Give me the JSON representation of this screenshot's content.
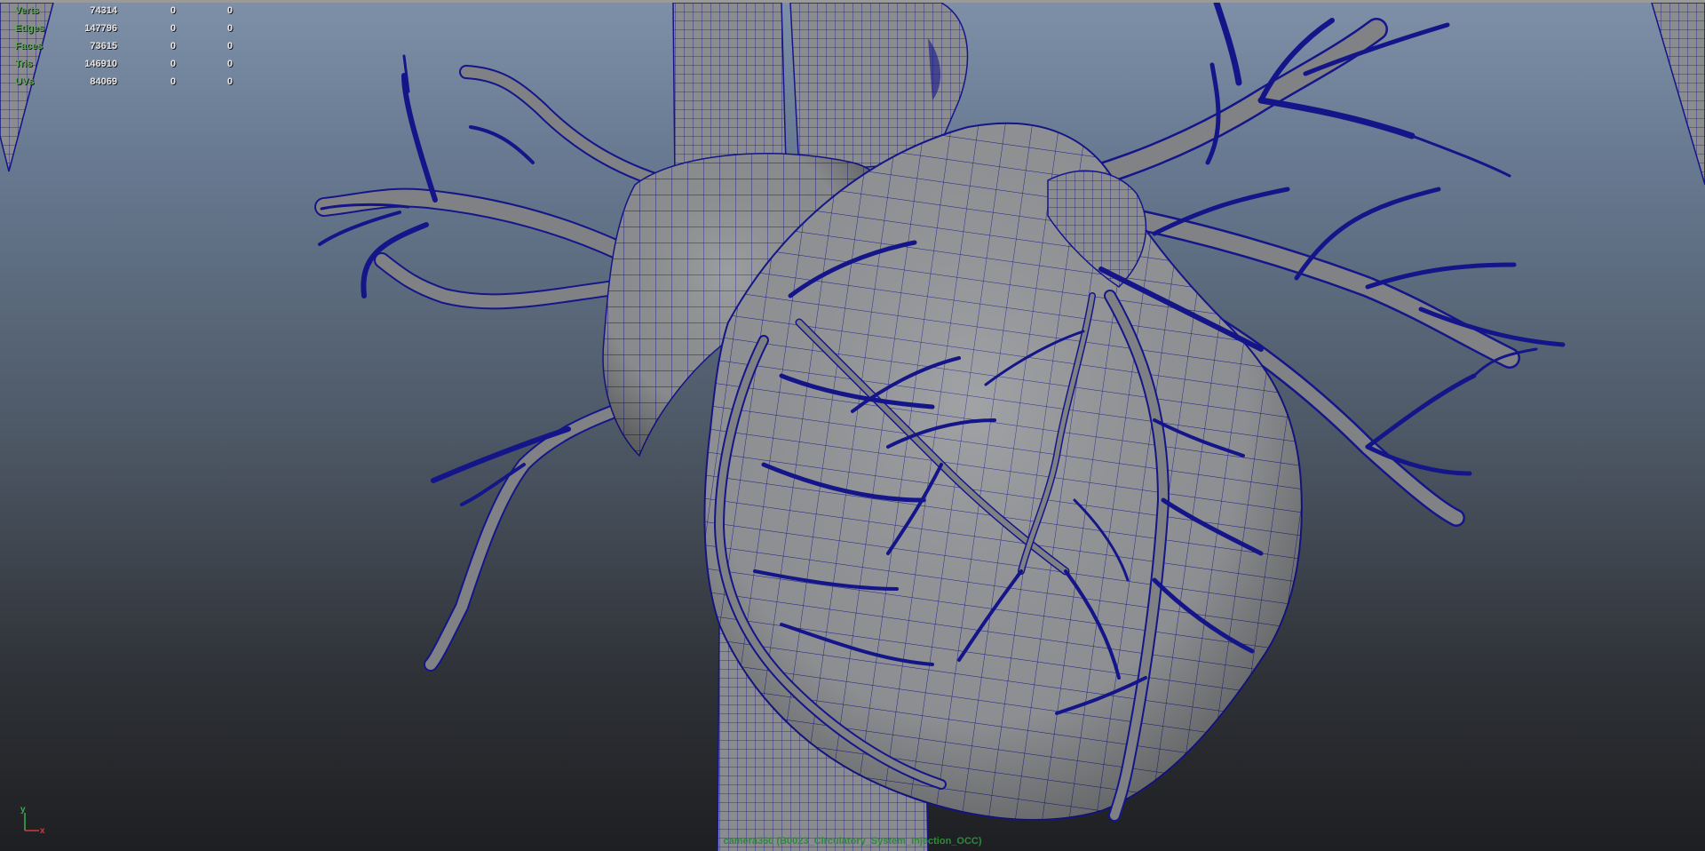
{
  "hud": {
    "rows": [
      {
        "label": "Verts",
        "v1": "74314",
        "v2": "0",
        "v3": "0"
      },
      {
        "label": "Edges",
        "v1": "147796",
        "v2": "0",
        "v3": "0"
      },
      {
        "label": "Faces",
        "v1": "73615",
        "v2": "0",
        "v3": "0"
      },
      {
        "label": "Tris",
        "v1": "146910",
        "v2": "0",
        "v3": "0"
      },
      {
        "label": "UVs",
        "v1": "84069",
        "v2": "0",
        "v3": "0"
      }
    ]
  },
  "axis": {
    "y": "y",
    "x": "x"
  },
  "camera": {
    "label": "camera360 (B0023_Circulatory_System_Injection_OCC)"
  },
  "colors": {
    "wire": "#15158a",
    "surface": "#8d8f92",
    "hud_label": "#5fa65f",
    "camera_label": "#2e8a3a"
  },
  "icons": [
    "axis-gizmo-icon"
  ]
}
